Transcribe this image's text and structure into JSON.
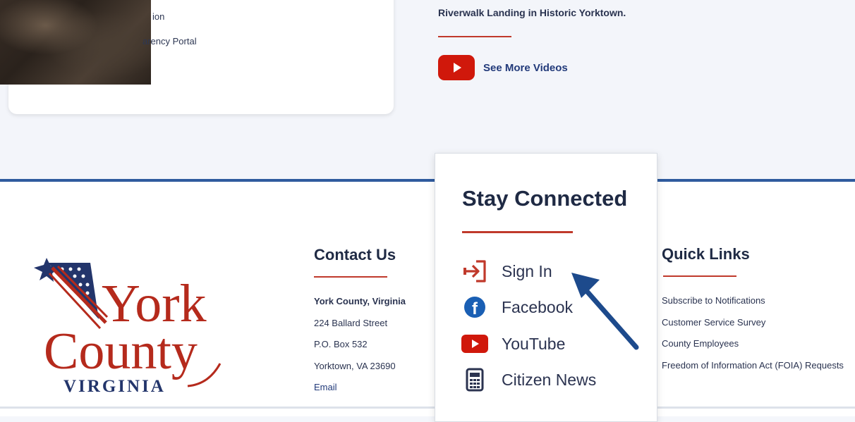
{
  "top_card": {
    "links": [
      "ion",
      "arency Portal"
    ]
  },
  "videos": {
    "caption": "Riverwalk Landing in Historic Yorktown.",
    "see_more_label": "See More Videos",
    "icon": "youtube-play-icon"
  },
  "logo": {
    "line1": "York",
    "line2": "County",
    "line3": "VIRGINIA",
    "colors": {
      "red": "#b52a1c",
      "blue": "#23356b"
    }
  },
  "contact": {
    "title": "Contact Us",
    "name": "York County, Virginia",
    "street": "224 Ballard Street",
    "po_box": "P.O. Box 532",
    "city": "Yorktown, VA 23690",
    "email": "Email"
  },
  "stay_connected": {
    "title": "Stay Connected",
    "items": [
      {
        "label": "Sign In",
        "icon": "sign-in-icon"
      },
      {
        "label": "Facebook",
        "icon": "facebook-icon"
      },
      {
        "label": "YouTube",
        "icon": "youtube-icon"
      },
      {
        "label": "Citizen News",
        "icon": "newspaper-icon"
      }
    ]
  },
  "quick_links": {
    "title": "Quick Links",
    "items": [
      "Subscribe to Notifications",
      "Customer Service Survey",
      "County Employees",
      "Freedom of Information Act (FOIA) Requests"
    ]
  },
  "colors": {
    "accent_red": "#c0392b",
    "navy": "#1f2a44",
    "link_blue": "#223a7a",
    "divider_blue": "#2f5b9e",
    "youtube_red": "#d0180b",
    "facebook_blue": "#1a5fb4",
    "annotation_arrow": "#1d4a8c"
  }
}
